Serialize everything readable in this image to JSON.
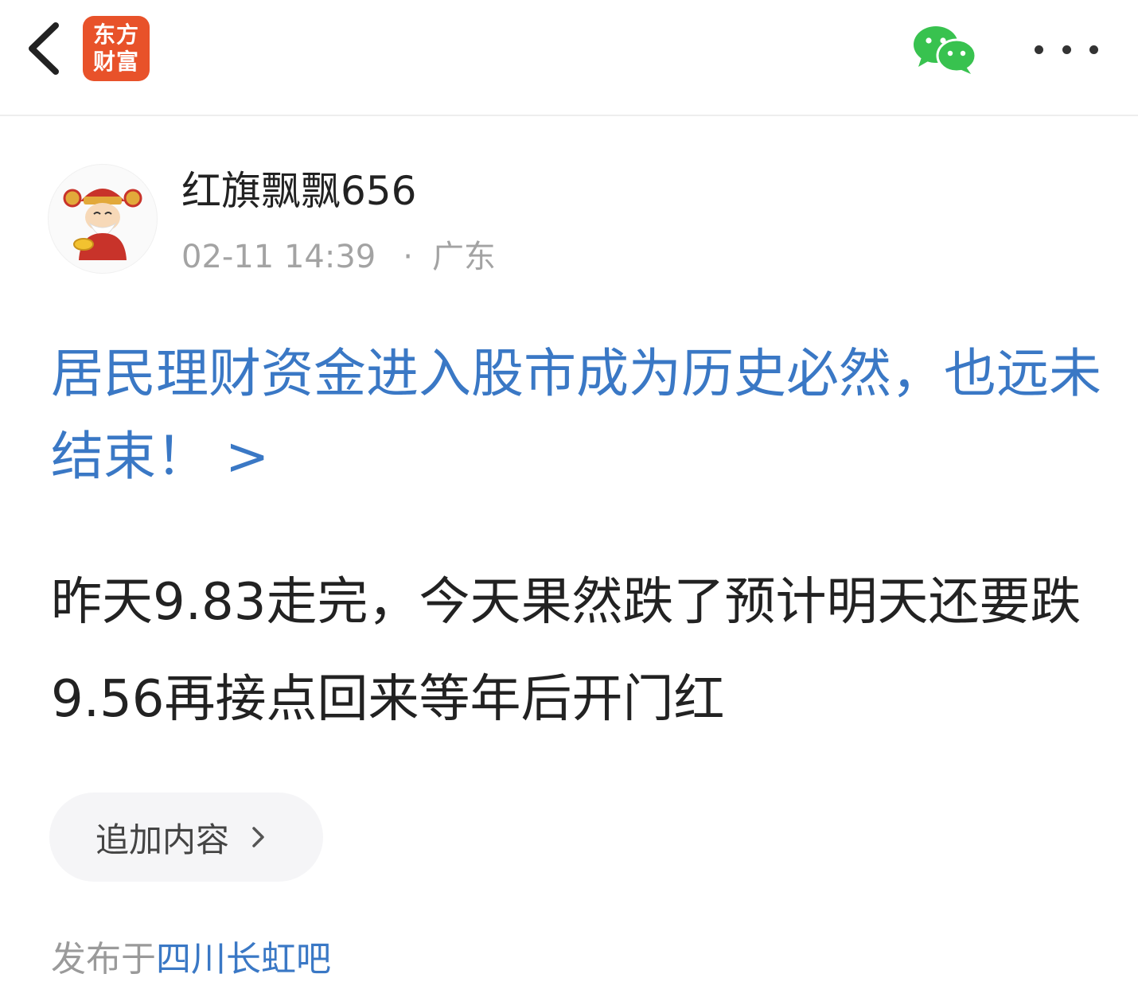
{
  "header": {
    "back_icon": "chevron-left-icon",
    "logo_line1": "东方",
    "logo_line2": "财富",
    "share_icon": "wechat-icon",
    "more_icon": "more-dots-icon",
    "logo_color": "#e8522a"
  },
  "author": {
    "name": "红旗飘飘656",
    "avatar_icon": "caishen-avatar",
    "time": "02-11 14:39",
    "separator": "·",
    "location": "广东"
  },
  "post": {
    "title": "居民理财资金进入股市成为历史必然，也远未结束！ >",
    "body": "昨天9.83走完，今天果然跌了预计明天还要跌9.56再接点回来等年后开门红",
    "title_color": "#3a78c5"
  },
  "actions": {
    "append_label": "追加内容",
    "append_icon": "chevron-right-icon"
  },
  "footer": {
    "published_prefix": "发布于",
    "forum_name": "四川长虹吧"
  }
}
